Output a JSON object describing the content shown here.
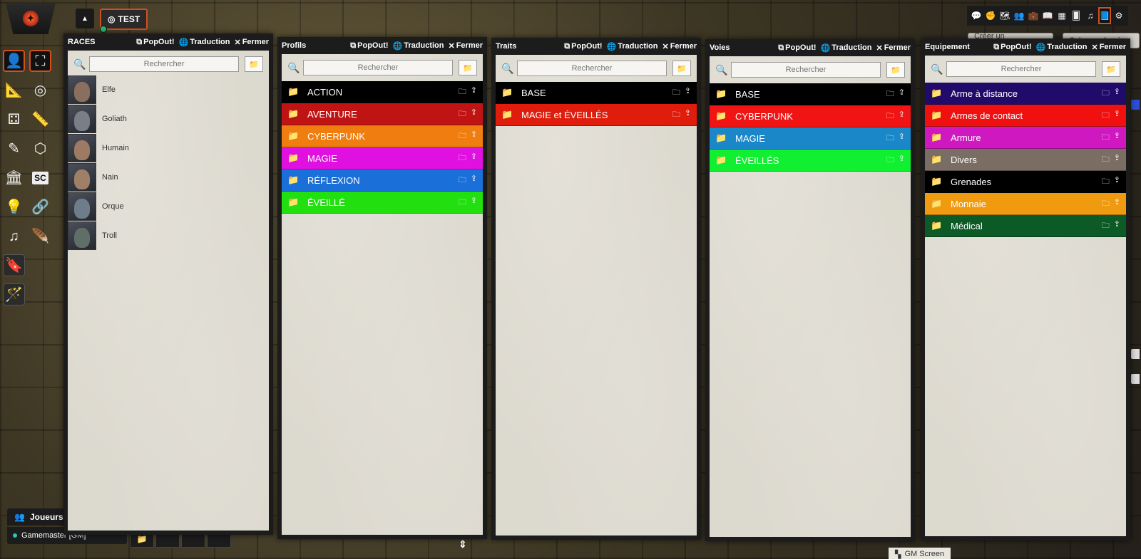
{
  "topbar": {
    "page_tab_label": "TEST"
  },
  "panels": {
    "races": {
      "title": "RACES",
      "popout": "PopOut!",
      "translate": "Traduction",
      "close": "Fermer",
      "search_placeholder": "Rechercher",
      "items": [
        {
          "label": "Elfe",
          "face_color": "#8a6f5e"
        },
        {
          "label": "Goliath",
          "face_color": "#7a7e86"
        },
        {
          "label": "Humain",
          "face_color": "#9c7a63"
        },
        {
          "label": "Nain",
          "face_color": "#a07f68"
        },
        {
          "label": "Orque",
          "face_color": "#6e7d8a"
        },
        {
          "label": "Troll",
          "face_color": "#5f6e66"
        }
      ]
    },
    "profils": {
      "title": "Profils",
      "popout": "PopOut!",
      "translate": "Traduction",
      "close": "Fermer",
      "search_placeholder": "Rechercher",
      "folders": [
        {
          "label": "ACTION",
          "color": "#000000"
        },
        {
          "label": "AVENTURE",
          "color": "#c01414"
        },
        {
          "label": "CYBERPUNK",
          "color": "#f07d10"
        },
        {
          "label": "MAGIE",
          "color": "#e010e0"
        },
        {
          "label": "RÉFLEXION",
          "color": "#1a6fd8"
        },
        {
          "label": "ÉVEILLÉ",
          "color": "#22e010"
        }
      ]
    },
    "traits": {
      "title": "Traits",
      "popout": "PopOut!",
      "translate": "Traduction",
      "close": "Fermer",
      "search_placeholder": "Rechercher",
      "folders": [
        {
          "label": "BASE",
          "color": "#000000"
        },
        {
          "label": "MAGIE et ÉVEILLÉS",
          "color": "#e01c0c"
        }
      ]
    },
    "voies": {
      "title": "Voies",
      "popout": "PopOut!",
      "translate": "Traduction",
      "close": "Fermer",
      "search_placeholder": "Rechercher",
      "folders": [
        {
          "label": "BASE",
          "color": "#000000"
        },
        {
          "label": "CYBERPUNK",
          "color": "#f01414"
        },
        {
          "label": "MAGIE",
          "color": "#1a88c8"
        },
        {
          "label": "ÉVEILLÉS",
          "color": "#10f030"
        }
      ]
    },
    "equipement": {
      "title": "Equipement",
      "popout": "PopOut!",
      "translate": "Traduction",
      "close": "Fermer",
      "search_placeholder": "Rechercher",
      "folders": [
        {
          "label": "Arme à distance",
          "color": "#200a6a"
        },
        {
          "label": "Armes de contact",
          "color": "#f01010"
        },
        {
          "label": "Armure",
          "color": "#d018c0"
        },
        {
          "label": "Divers",
          "color": "#7a6e64"
        },
        {
          "label": "Grenades",
          "color": "#000000"
        },
        {
          "label": "Monnaie",
          "color": "#f09a10"
        },
        {
          "label": "Médical",
          "color": "#0c5a26"
        }
      ]
    }
  },
  "right": {
    "create_compendium": "Créer un compendium",
    "create_folder": "Créer un dossier"
  },
  "bottom": {
    "players_label": "Joueurs",
    "gm_player": "Gamemaster [GM]",
    "gm_screen": "GM Screen"
  },
  "colors": {
    "accent": "#d0501e"
  }
}
